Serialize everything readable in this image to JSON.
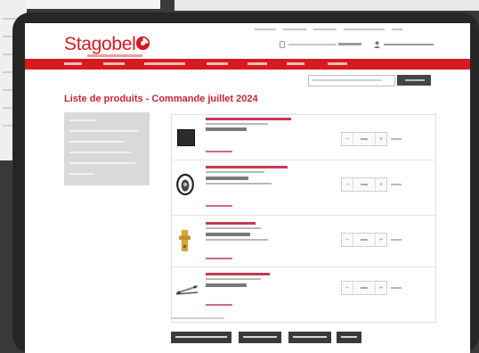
{
  "page": {
    "brand": "Stagobel",
    "title": "Liste de produits - Commande juillet 2024"
  },
  "products": [
    {
      "thumbnail": "black-square-panel"
    },
    {
      "thumbnail": "black-cable-reel"
    },
    {
      "thumbnail": "gold-hardware-piece"
    },
    {
      "thumbnail": "metal-bar-bracket"
    }
  ],
  "colors": {
    "brand_red": "#d71920",
    "title_red": "#c8243a",
    "tablet_frame": "#262626",
    "sidebar_gray": "#d9d9d9",
    "button_dark": "#3a3a3a"
  },
  "icons": {
    "logo": "stagobel-logo-mark",
    "phone": "phone-icon",
    "login": "user-icon"
  }
}
